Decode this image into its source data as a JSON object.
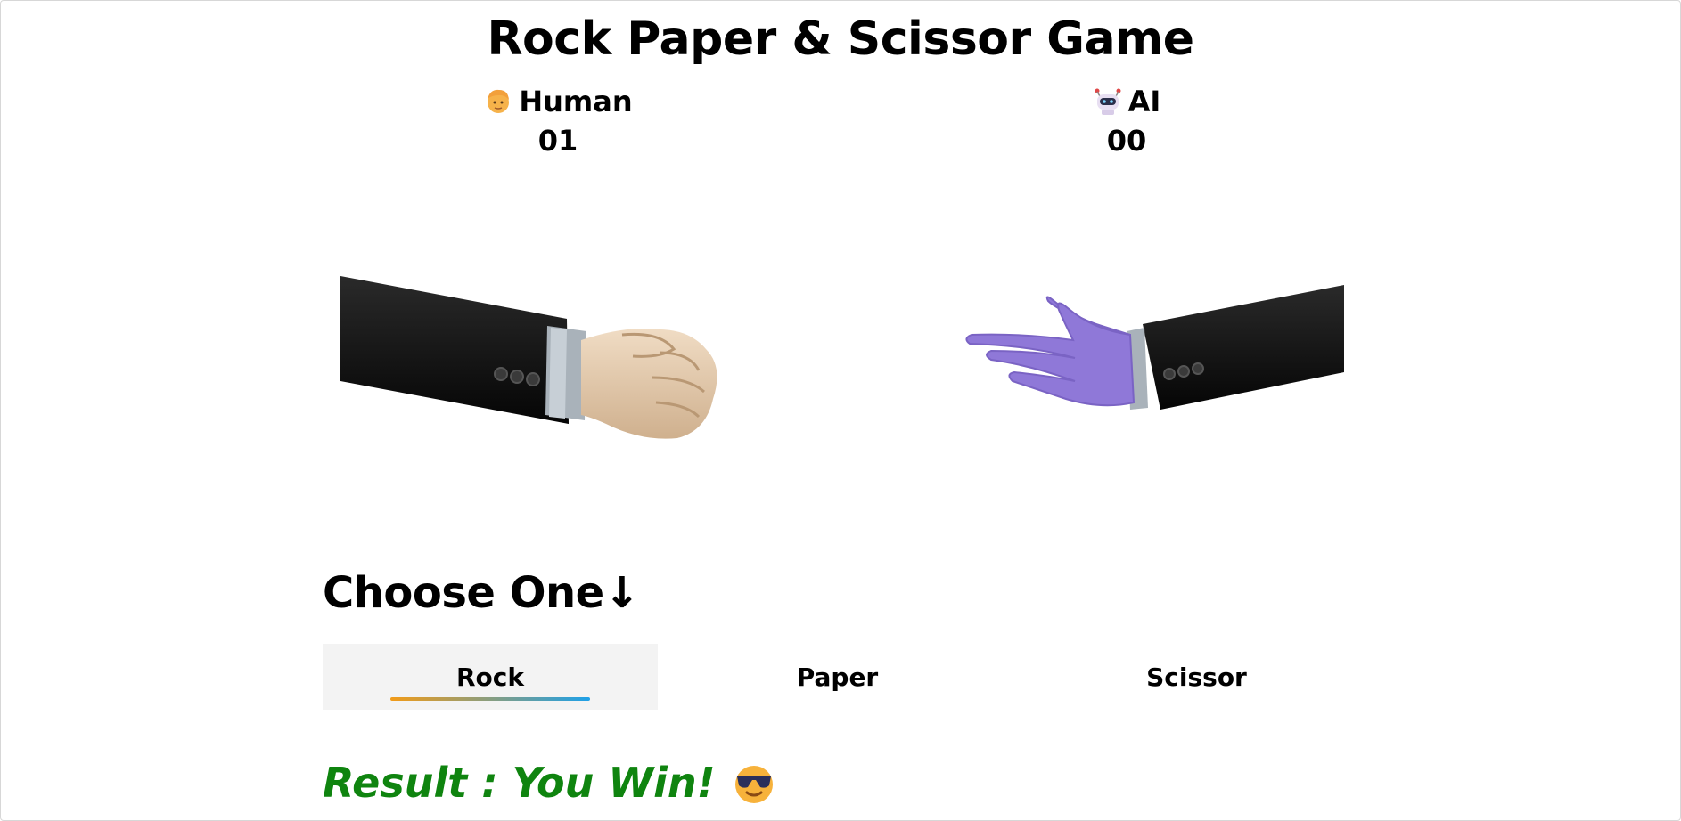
{
  "title": "Rock Paper & Scissor Game",
  "players": {
    "human": {
      "name": "Human",
      "score": "01",
      "icon": "person-emoji-icon"
    },
    "ai": {
      "name": "AI",
      "score": "00",
      "icon": "robot-emoji-icon"
    }
  },
  "hands": {
    "human": "rock",
    "ai": "paper"
  },
  "choose_label": "Choose One↓",
  "options": [
    "Rock",
    "Paper",
    "Scissor"
  ],
  "selected_option": "Rock",
  "result": {
    "text": "Result : You Win!",
    "icon": "sunglasses-emoji-icon",
    "color": "#0f840f"
  },
  "colors": {
    "underline_start": "#f29b18",
    "underline_end": "#1ea0e8",
    "glove": "#8f78d8",
    "sleeve": "#151515"
  }
}
